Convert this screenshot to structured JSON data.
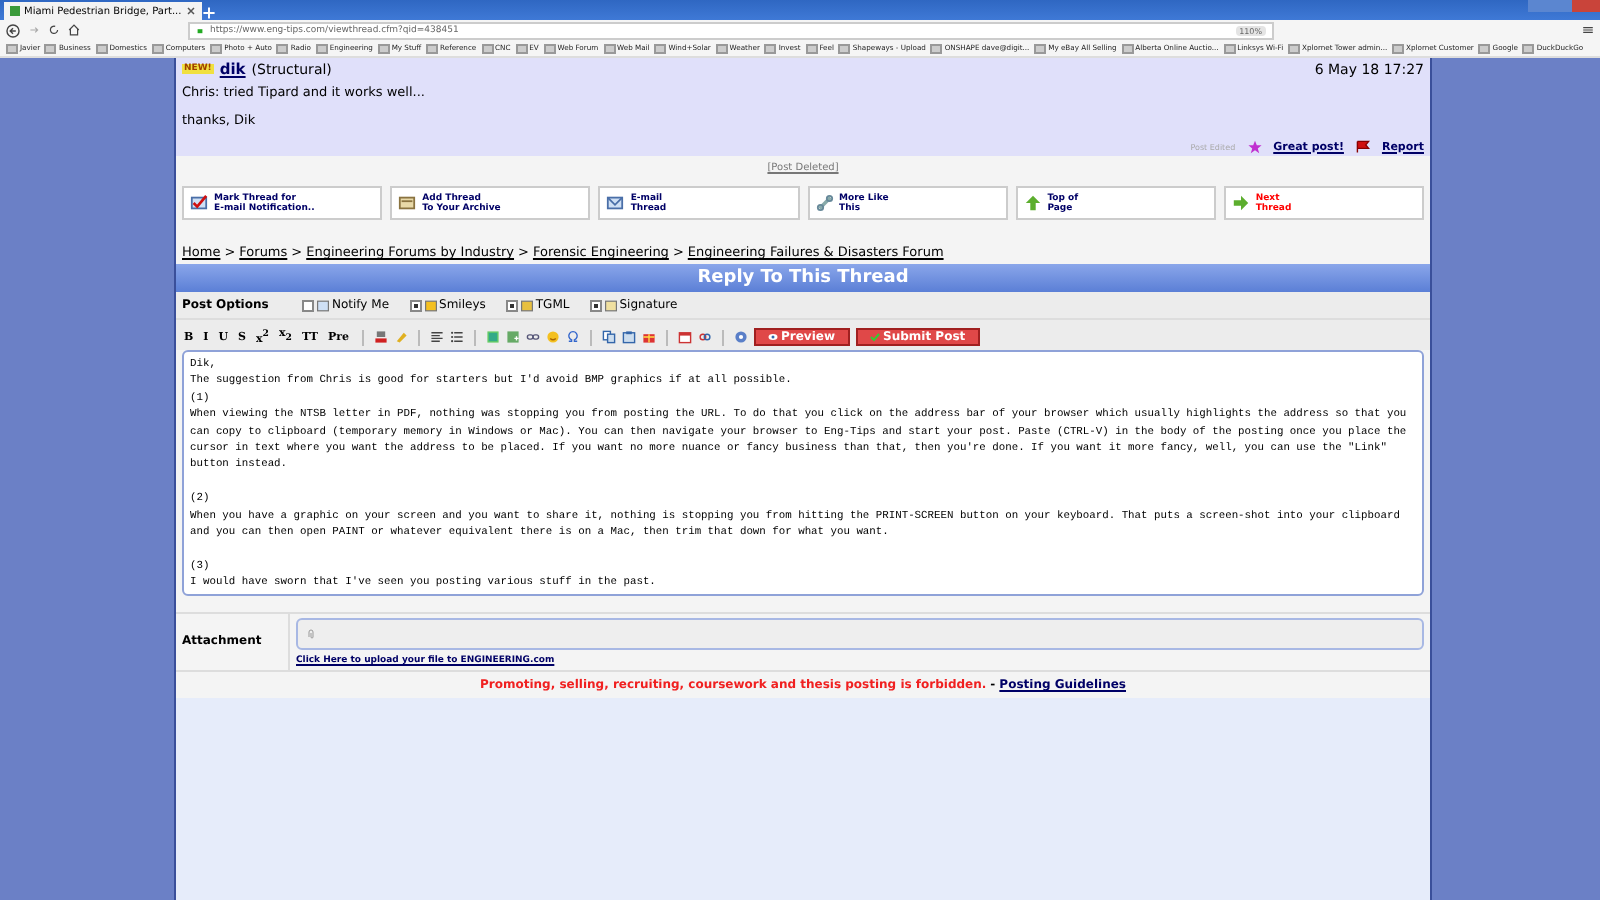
{
  "browser": {
    "tab_title": "Miami Pedestrian Bridge, Part...",
    "url": "https://www.eng-tips.com/viewthread.cfm?qid=438451",
    "zoom": "110%",
    "bookmarks": [
      "Javier",
      "Business",
      "Domestics",
      "Computers",
      "Photo + Auto",
      "Radio",
      "Engineering",
      "My Stuff",
      "Reference",
      "CNC",
      "EV",
      "Web Forum",
      "Web Mail",
      "Wind+Solar",
      "Weather",
      "Invest",
      "Feel",
      "Shapeways - Upload",
      "ONSHAPE dave@digit...",
      "My eBay All Selling",
      "Alberta Online Auctio...",
      "Linksys Wi-Fi",
      "Xplornet Tower admin...",
      "Xplornet Customer",
      "Google",
      "DuckDuckGo"
    ]
  },
  "post": {
    "badge": "NEW!",
    "author": "dik",
    "role": "(Structural)",
    "date": "6 May 18 17:27",
    "body": [
      "Chris: tried Tipard and it works well...",
      "thanks, Dik"
    ],
    "edited": "Post Edited",
    "great_post": "Great post!",
    "report": "Report"
  },
  "deleted_notice": "[Post Deleted]",
  "thread_buttons": [
    {
      "lines": [
        "Mark Thread for",
        "E-mail Notification.."
      ],
      "color": "#000066"
    },
    {
      "lines": [
        "Add Thread",
        "To Your Archive"
      ],
      "color": "#000066"
    },
    {
      "lines": [
        "E-mail",
        "Thread"
      ],
      "color": "#000066"
    },
    {
      "lines": [
        "More Like",
        "This"
      ],
      "color": "#000066"
    },
    {
      "lines": [
        "Top of",
        "Page"
      ],
      "color": "#000066"
    },
    {
      "lines": [
        "Next",
        "Thread"
      ],
      "color": "#ff0000"
    }
  ],
  "breadcrumb": {
    "separator": ">",
    "items": [
      "Home",
      "Forums",
      "Engineering Forums by Industry",
      "Forensic Engineering",
      "Engineering Failures & Disasters Forum"
    ]
  },
  "reply": {
    "title": "Reply To This Thread",
    "options_label": "Post Options",
    "options": [
      {
        "label": "Notify Me",
        "checked": false
      },
      {
        "label": "Smileys",
        "checked": true
      },
      {
        "label": "TGML",
        "checked": true
      },
      {
        "label": "Signature",
        "checked": true
      }
    ],
    "format_buttons": [
      "B",
      "I",
      "U",
      "S",
      "x$^{2}$",
      "x$_{2}$",
      "TT",
      "Pre"
    ],
    "preview": "Preview",
    "submit": "Submit Post",
    "paragraphs": [
      [
        "Dik,",
        "The suggestion from Chris is good for starters but I'd avoid BMP graphics if at all possible.",
        "(1)",
        "When viewing the NTSB letter in PDF, nothing was stopping you from posting the URL.  To do that you click on the address bar of your browser which usually highlights the address so that you can copy to clipboard (temporary memory in Windows or Mac).  You can then navigate your browser to Eng-Tips and start your post.  Paste (CTRL-V) in the body of the posting once you place the cursor in text where you want the address to be placed. If you want no more nuance or fancy business than that, then you're done.  If you want it more fancy, well, you can use the \"Link\" button instead."
      ],
      [
        "(2)",
        "When you have a graphic on your screen and you want to share it, nothing is stopping you from hitting the PRINT-SCREEN button on your keyboard.  That puts a screen-shot into your clipboard and you can then open PAINT or whatever equivalent there is on a Mac, then trim that down for what you want."
      ],
      [
        "(3)",
        "I would have sworn that I've seen you posting various stuff in the past."
      ]
    ],
    "attachment_label": "Attachment",
    "upload_link": "Click Here to upload your file to ENGINEERING.com",
    "notice": "Promoting, selling, recruiting, coursework and thesis posting is forbidden.",
    "notice_separator": "-",
    "guidelines": "Posting Guidelines"
  }
}
